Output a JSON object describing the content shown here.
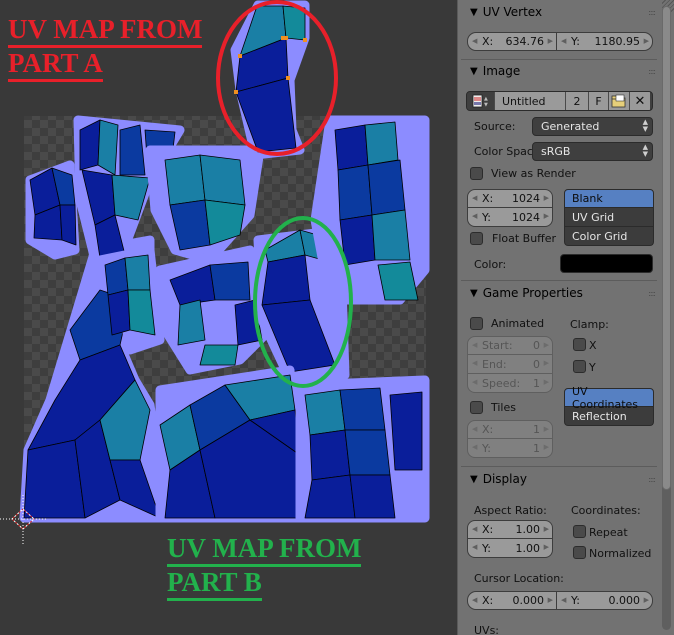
{
  "viewport": {
    "annotations": [
      {
        "id": "part-a",
        "lines": [
          "UV MAP FROM",
          "PART A"
        ],
        "color": "#e8202a"
      },
      {
        "id": "part-b",
        "lines": [
          "UV MAP FROM ",
          "PART B"
        ],
        "color": "#22b14c"
      }
    ],
    "highlight_colors": {
      "part_a_circle": "#e8202a",
      "part_b_circle": "#22b14c",
      "selected_vertex": "#f09020",
      "uv_island_outline": "#8c8cff"
    }
  },
  "panel": {
    "uv_vertex": {
      "title": "UV Vertex",
      "x": {
        "label": "X:",
        "value": "634.76"
      },
      "y": {
        "label": "Y:",
        "value": "1180.95"
      }
    },
    "image": {
      "title": "Image",
      "name": "Untitled",
      "users": "2",
      "fake_user": "F",
      "source_label": "Source:",
      "source_value": "Generated",
      "color_space_label": "Color Spac",
      "color_space_value": "sRGB",
      "view_as_render": "View as Render",
      "size_x": {
        "label": "X:",
        "value": "1024"
      },
      "size_y": {
        "label": "Y:",
        "value": "1024"
      },
      "float_buffer": "Float Buffer",
      "generated_types": [
        {
          "label": "Blank",
          "active": true
        },
        {
          "label": "UV Grid",
          "active": false
        },
        {
          "label": "Color Grid",
          "active": false
        }
      ],
      "color_label": "Color:",
      "color_value": "#000000"
    },
    "game_properties": {
      "title": "Game Properties",
      "animated": "Animated",
      "start": {
        "label": "Start:",
        "value": "0"
      },
      "end": {
        "label": "End:",
        "value": "0"
      },
      "speed": {
        "label": "Speed:",
        "value": "1"
      },
      "clamp_label": "Clamp:",
      "clamp_x": "X",
      "clamp_y": "Y",
      "mapping": [
        {
          "label": "UV Coordinates",
          "active": true
        },
        {
          "label": "Reflection",
          "active": false
        }
      ],
      "tiles": "Tiles",
      "tiles_x": {
        "label": "X:",
        "value": "1"
      },
      "tiles_y": {
        "label": "Y:",
        "value": "1"
      }
    },
    "display": {
      "title": "Display",
      "aspect_label": "Aspect Ratio:",
      "aspect_x": {
        "label": "X:",
        "value": "1.00"
      },
      "aspect_y": {
        "label": "Y:",
        "value": "1.00"
      },
      "coordinates_label": "Coordinates:",
      "repeat": "Repeat",
      "normalized": "Normalized",
      "cursor_label": "Cursor Location:",
      "cursor_x": {
        "label": "X:",
        "value": "0.000"
      },
      "cursor_y": {
        "label": "Y:",
        "value": "0.000"
      },
      "uvs_label": "UVs:"
    }
  }
}
